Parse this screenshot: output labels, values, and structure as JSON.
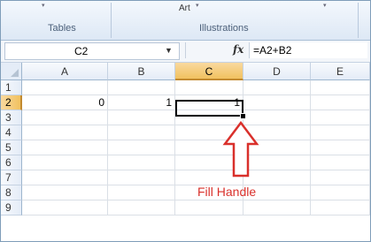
{
  "ribbon": {
    "group_tables": "Tables",
    "group_illustrations": "Illustrations",
    "art_label": "Art"
  },
  "formula_bar": {
    "name_box": "C2",
    "fx_label": "fx",
    "formula": "=A2+B2"
  },
  "grid": {
    "columns": [
      "A",
      "B",
      "C",
      "D",
      "E"
    ],
    "rows": [
      "1",
      "2",
      "3",
      "4",
      "5",
      "6",
      "7",
      "8",
      "9"
    ],
    "active_cell": "C2",
    "cells": {
      "A2": "0",
      "B2": "1",
      "C2": "1"
    }
  },
  "annotation": {
    "text": "Fill Handle",
    "color": "#d9302b"
  }
}
